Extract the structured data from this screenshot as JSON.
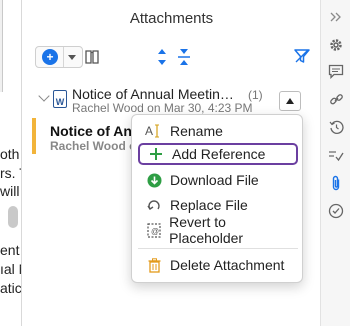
{
  "document": {
    "lines": [
      "oth",
      "rs. T",
      "will",
      "ent",
      "ıal N",
      "atic"
    ]
  },
  "panel": {
    "title": "Attachments"
  },
  "toolbar": {
    "add_icon": "plus-circle-icon",
    "add_menu_icon": "chevron-down-icon",
    "library_icon": "book-icon",
    "expand_icon": "expand-all-icon",
    "collapse_icon": "collapse-all-icon",
    "filter_icon": "filter-icon",
    "accent_color": "#1a73e8"
  },
  "attachment": {
    "title": "Notice of Annual Meetin…",
    "count": "(1)",
    "meta": "Rachel Wood on Mar 30, 4:23 PM",
    "type_icon": "word-document-icon"
  },
  "sub_item": {
    "title": "Notice of Ann",
    "meta": "Rachel Wood o",
    "highlight_color": "#f2b43a"
  },
  "context_menu": {
    "items": [
      {
        "label": "Rename",
        "icon": "text-cursor-icon",
        "highlighted": false
      },
      {
        "label": "Add Reference",
        "icon": "plus-icon",
        "highlighted": true
      },
      {
        "label": "Download File",
        "icon": "download-circle-icon",
        "highlighted": false
      },
      {
        "label": "Replace File",
        "icon": "replace-icon",
        "highlighted": false
      },
      {
        "label": "Revert to Placeholder",
        "icon": "placeholder-icon",
        "highlighted": false
      },
      {
        "label": "Delete Attachment",
        "icon": "trash-icon",
        "highlighted": false
      }
    ],
    "highlight_color": "#6b3fa0"
  },
  "right_rail": {
    "icons": [
      "double-chevron-right-icon",
      "gear-icon",
      "comment-icon",
      "link-icon",
      "history-icon",
      "tracked-changes-icon",
      "paperclip-icon",
      "check-circle-icon"
    ],
    "active_color": "#1a73e8"
  }
}
